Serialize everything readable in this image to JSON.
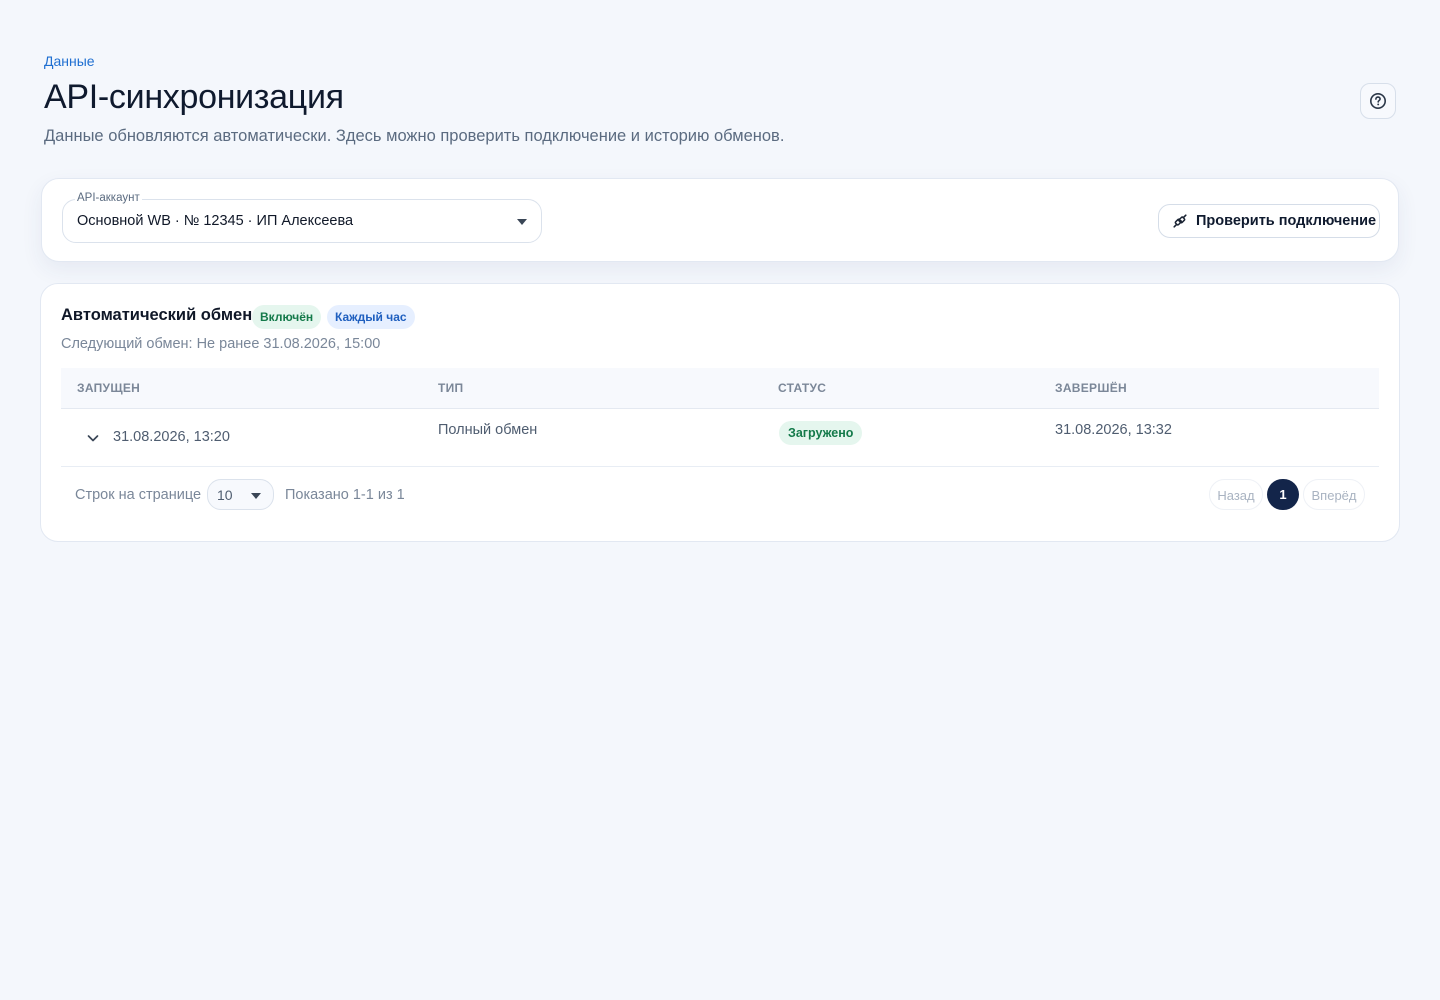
{
  "header": {
    "breadcrumb": "Данные",
    "title": "API-синхронизация",
    "subtitle": "Данные обновляются автоматически. Здесь можно проверить подключение и историю обменов.",
    "help_icon": "help-circle-icon"
  },
  "account": {
    "label": "API-аккаунт",
    "selected": "Основной WB · № 12345 · ИП Алексеева",
    "check_button": "Проверить подключение",
    "check_icon": "plug-connect-icon"
  },
  "exchange": {
    "title": "Автоматический обмен",
    "status_badge": "Включён",
    "frequency_badge": "Каждый час",
    "next_exchange": "Следующий обмен: Не ранее 31.08.2026, 15:00",
    "columns": [
      "ЗАПУЩЕН",
      "ТИП",
      "СТАТУС",
      "ЗАВЕРШЁН"
    ],
    "rows": [
      {
        "started": "31.08.2026, 13:20",
        "type": "Полный обмен",
        "status": "Загружено",
        "finished": "31.08.2026, 13:32"
      }
    ],
    "pagination": {
      "rows_per_page_label": "Строк на странице",
      "rows_per_page": "10",
      "shown": "Показано 1-1 из 1",
      "prev": "Назад",
      "current_page": "1",
      "next": "Вперёд"
    }
  },
  "colors": {
    "accent": "#1f6fd1",
    "success_bg": "#e5f6ee",
    "success_text": "#147a4a",
    "info_bg": "#e6efff",
    "info_text": "#1f5fbf",
    "page_active": "#13254a",
    "background": "#f4f7fc"
  }
}
